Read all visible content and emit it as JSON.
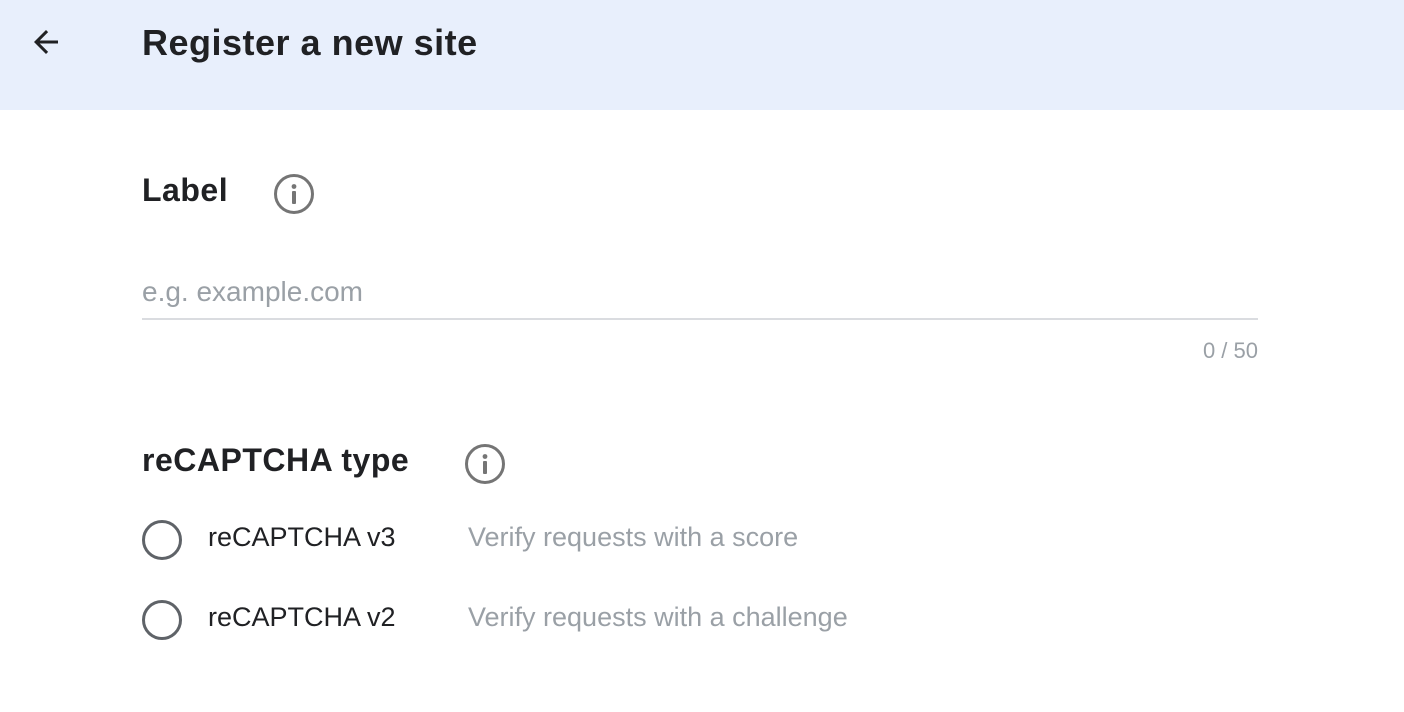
{
  "header": {
    "title": "Register a new site",
    "back_icon": "arrow-back-icon",
    "background": "#e8effc"
  },
  "label_section": {
    "title": "Label",
    "info_icon": "info-icon",
    "input": {
      "value": "",
      "placeholder": "e.g. example.com"
    },
    "counter": "0 / 50"
  },
  "type_section": {
    "title": "reCAPTCHA type",
    "info_icon": "info-icon",
    "options": [
      {
        "label": "reCAPTCHA v3",
        "description": "Verify requests with a score",
        "selected": false
      },
      {
        "label": "reCAPTCHA v2",
        "description": "Verify requests with a challenge",
        "selected": false
      }
    ]
  }
}
